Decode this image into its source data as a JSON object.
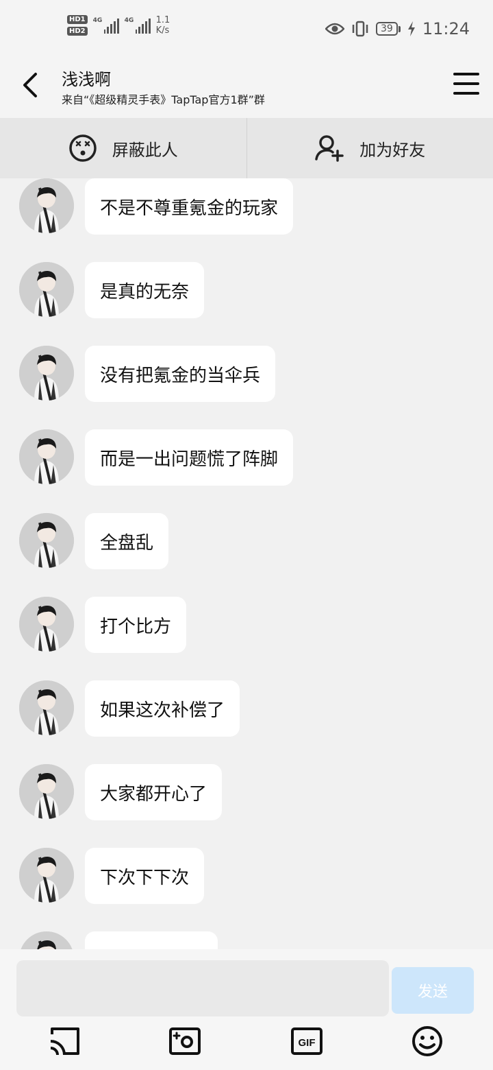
{
  "status_bar": {
    "hd1": "HD1",
    "hd2": "HD2",
    "signal1": "4G",
    "signal2": "4G",
    "speed_value": "1.1",
    "speed_unit": "K/s",
    "battery": "39",
    "time": "11:24"
  },
  "header": {
    "title": "浅浅啊",
    "subtitle": "来自“《超级精灵手表》TapTap官方1群”群"
  },
  "actions": {
    "block_label": "屏蔽此人",
    "add_friend_label": "加为好友"
  },
  "messages": [
    "不是不尊重氪金的玩家",
    "是真的无奈",
    "没有把氪金的当伞兵",
    "而是一出问题慌了阵脚",
    "全盘乱",
    "打个比方",
    "如果这次补偿了",
    "大家都开心了",
    "下次下下次",
    ""
  ],
  "composer": {
    "input_value": "",
    "send_label": "发送",
    "gif_label": "GIF"
  },
  "colors": {
    "send_disabled": "#cde6fb",
    "background": "#f1f1f1"
  }
}
